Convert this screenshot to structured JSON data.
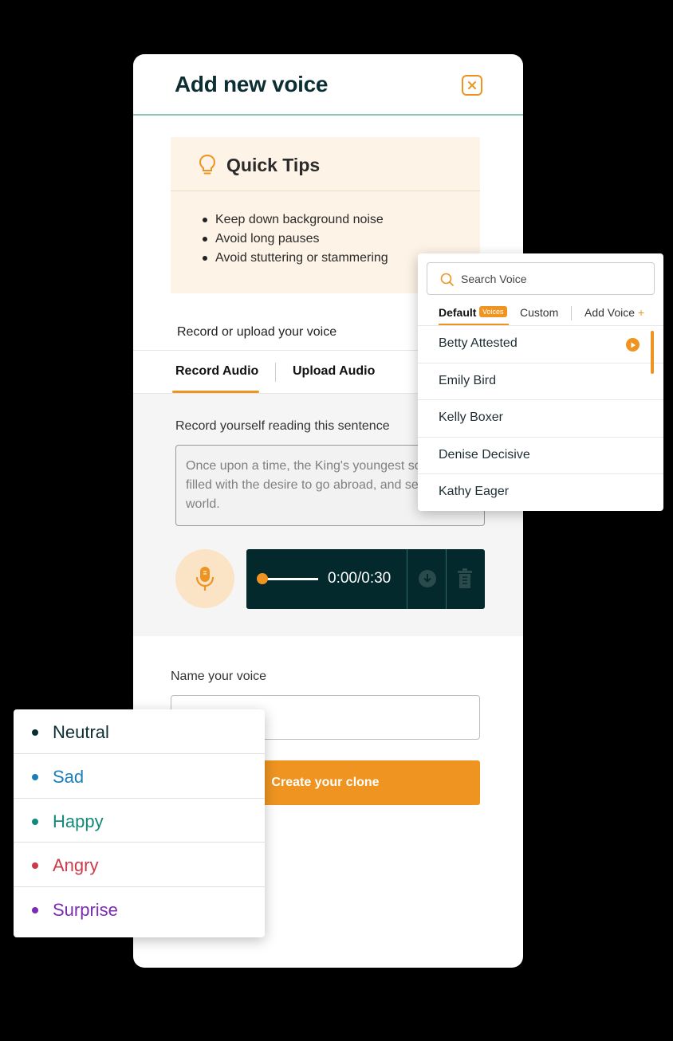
{
  "modal": {
    "title": "Add new voice",
    "tips": {
      "title": "Quick Tips",
      "items": [
        "Keep down background noise",
        "Avoid long pauses",
        "Avoid stuttering or stammering"
      ]
    },
    "record_label": "Record or upload your voice",
    "tabs": {
      "record": "Record Audio",
      "upload": "Upload Audio"
    },
    "record_prompt": "Record yourself reading this sentence",
    "sentence": "Once upon a time, the King's youngest son was filled with the desire to go abroad, and see the world.",
    "player": {
      "time": "0:00/0:30",
      "progress": 0
    },
    "name_label": "Name your voice",
    "name_value": "",
    "create_button": "Create your clone"
  },
  "voice_panel": {
    "search_placeholder": "Search Voice",
    "tabs": {
      "default": "Default",
      "badge": "Voices",
      "custom": "Custom",
      "add": "Add Voice",
      "add_icon": "+"
    },
    "voices": [
      "Betty Attested",
      "Emily Bird",
      "Kelly Boxer",
      "Denise Decisive",
      "Kathy Eager"
    ]
  },
  "emotions": [
    {
      "label": "Neutral",
      "color": "#0b2e33"
    },
    {
      "label": "Sad",
      "color": "#1a7fb8"
    },
    {
      "label": "Happy",
      "color": "#13897a"
    },
    {
      "label": "Angry",
      "color": "#cc3a4a"
    },
    {
      "label": "Surprise",
      "color": "#7a2cb3"
    }
  ],
  "colors": {
    "accent": "#ef9420",
    "dark": "#04292d"
  }
}
